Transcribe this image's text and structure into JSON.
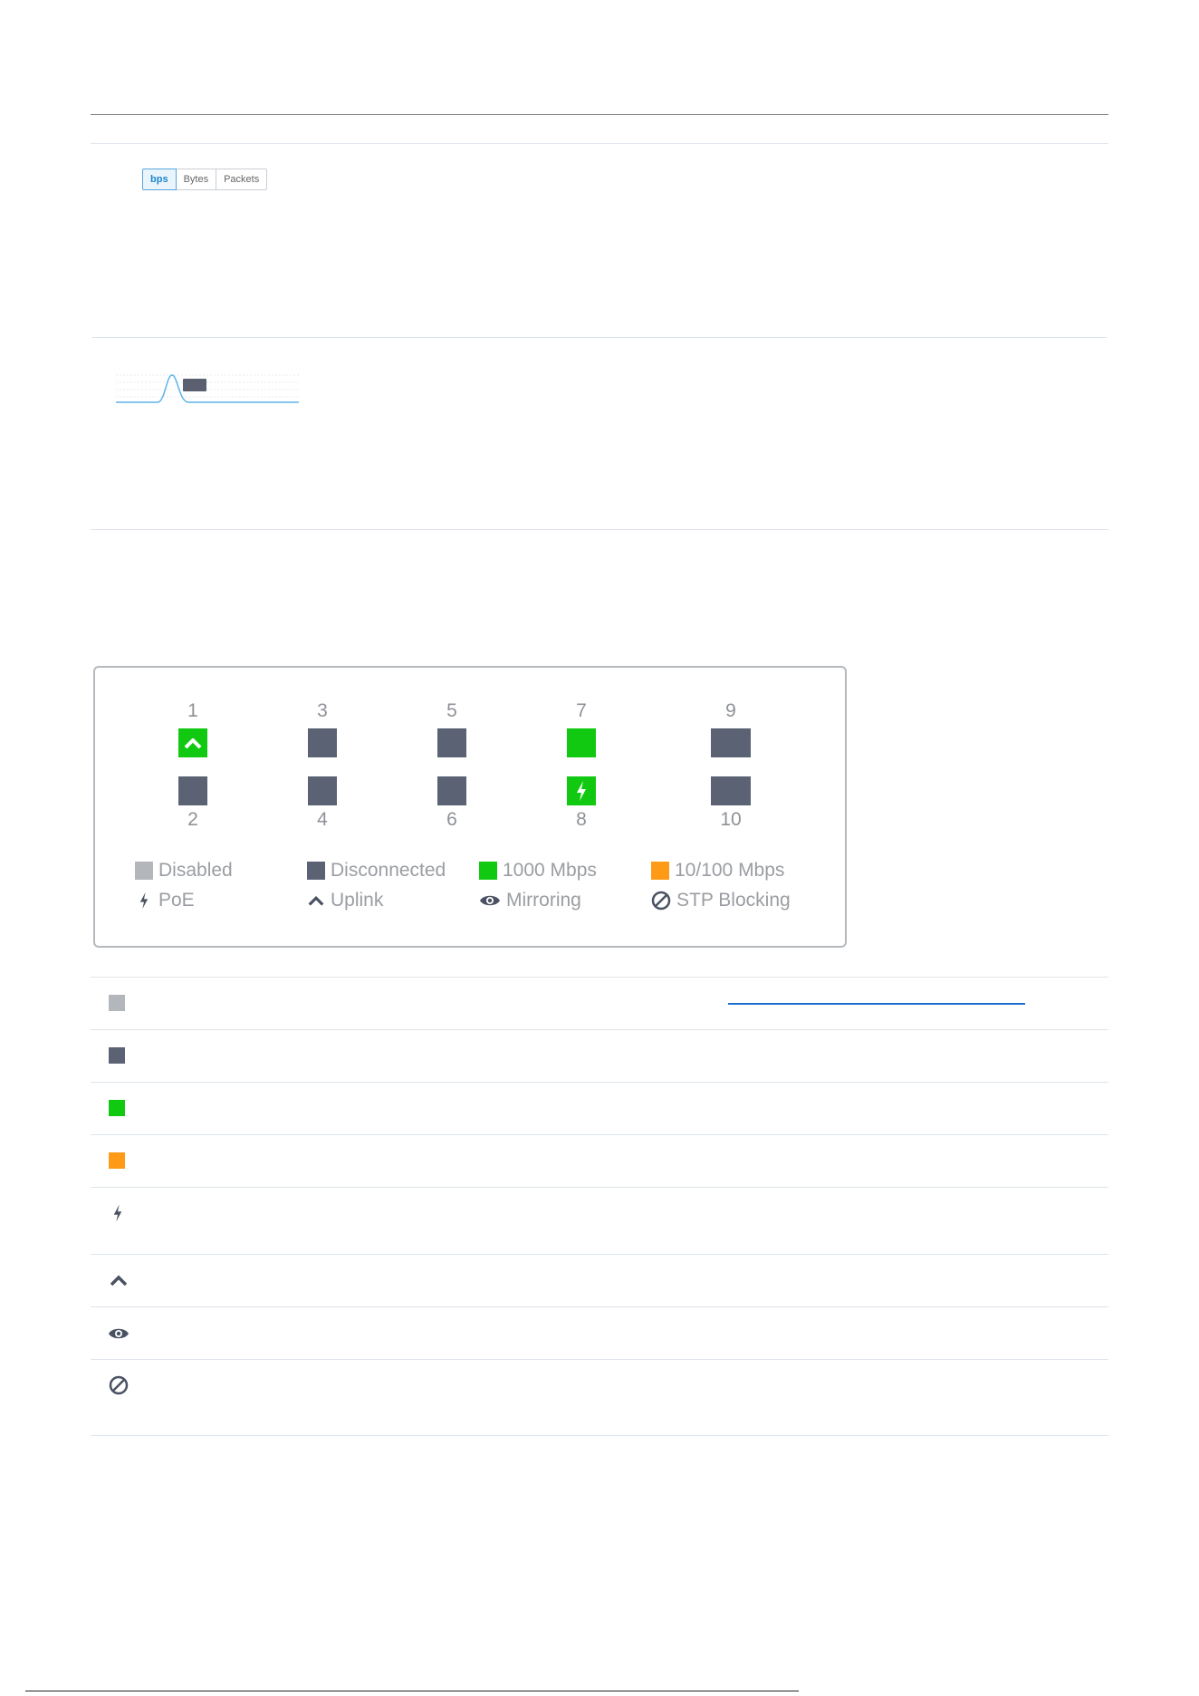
{
  "toggle": {
    "options": [
      "bps",
      "Bytes",
      "Packets"
    ],
    "active": "bps"
  },
  "colors": {
    "disabled": "#b3b6ba",
    "disconnected": "#5b6273",
    "gigabit": "#12c912",
    "fast": "#ff9a17",
    "icon": "#4a5262"
  },
  "ports": {
    "top_numbers": [
      "1",
      "3",
      "5",
      "7",
      "9"
    ],
    "bottom_numbers": [
      "2",
      "4",
      "6",
      "8",
      "10"
    ]
  },
  "legend": {
    "disabled": "Disabled",
    "disconnected": "Disconnected",
    "gigabit": "1000 Mbps",
    "fast": "10/100 Mbps",
    "poe": "PoE",
    "uplink": "Uplink",
    "mirroring": "Mirroring",
    "stp": "STP Blocking"
  },
  "icons": [
    "lightning-icon",
    "chevron-up-icon",
    "eye-icon",
    "blocked-icon"
  ]
}
